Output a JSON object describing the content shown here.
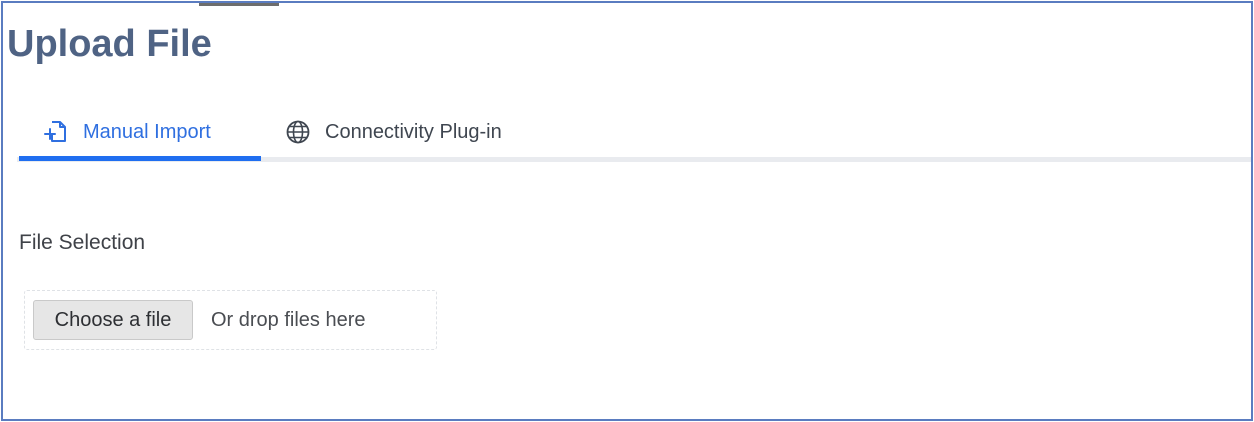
{
  "page": {
    "title": "Upload File"
  },
  "tabs": [
    {
      "label": "Manual Import",
      "icon": "file-import-icon",
      "active": true
    },
    {
      "label": "Connectivity Plug-in",
      "icon": "globe-icon",
      "active": false
    }
  ],
  "file_selection": {
    "label": "File Selection",
    "choose_button_label": "Choose a file",
    "drop_hint": "Or drop files here"
  },
  "colors": {
    "frame_border": "#5a7cc0",
    "title": "#4f6384",
    "active_tab": "#2f6fe0",
    "active_underline": "#1f6ef0",
    "inactive_tab": "#3f4650",
    "button_bg": "#e6e6e6"
  }
}
